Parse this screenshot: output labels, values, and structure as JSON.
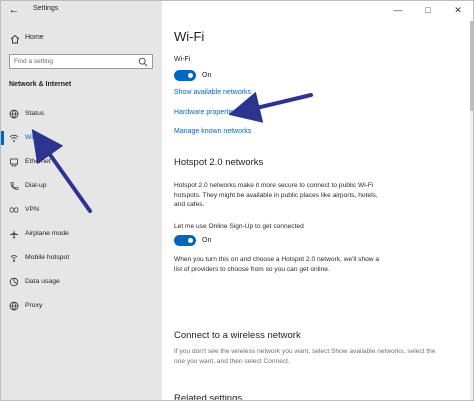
{
  "window": {
    "app_title": "Settings",
    "controls": {
      "minimize": "—",
      "maximize": "□",
      "close": "✕"
    }
  },
  "sidebar": {
    "home": "Home",
    "search_placeholder": "Find a setting",
    "section": "Network & Internet",
    "items": [
      {
        "label": "Status",
        "icon": "globe-icon"
      },
      {
        "label": "Wi-Fi",
        "icon": "wifi-icon"
      },
      {
        "label": "Ethernet",
        "icon": "ethernet-icon"
      },
      {
        "label": "Dial-up",
        "icon": "phone-icon"
      },
      {
        "label": "VPN",
        "icon": "vpn-icon"
      },
      {
        "label": "Airplane mode",
        "icon": "airplane-icon"
      },
      {
        "label": "Mobile hotspot",
        "icon": "hotspot-icon"
      },
      {
        "label": "Data usage",
        "icon": "data-usage-icon"
      },
      {
        "label": "Proxy",
        "icon": "globe-icon"
      }
    ]
  },
  "main": {
    "title": "Wi-Fi",
    "wifi_label": "Wi-Fi",
    "wifi_toggle": "On",
    "links": {
      "show_networks": "Show available networks",
      "hardware": "Hardware properties",
      "manage": "Manage known networks"
    },
    "hotspot": {
      "title": "Hotspot 2.0 networks",
      "desc1": "Hotspot 2.0 networks make it more secure to connect to public Wi-Fi",
      "desc2": "hotspots. They might be available in public places like airports, hotels,",
      "desc3": "and cafes.",
      "signup_label": "Let me use Online Sign-Up to get connected",
      "signup_toggle": "On",
      "note1": "When you turn this on and choose a Hotspot 2.0 network, we'll show a",
      "note2": "list of providers to choose from so you can get online."
    },
    "connect": {
      "title": "Connect to a wireless network",
      "desc1": "If you don't see the wireless network you want, select Show available networks, select the",
      "desc2": "one you want, and then select Connect."
    },
    "related": {
      "title": "Related settings"
    }
  },
  "colors": {
    "accent": "#0067c0",
    "sidebar_bg": "#e6e6e6",
    "arrow": "#2b3590"
  }
}
